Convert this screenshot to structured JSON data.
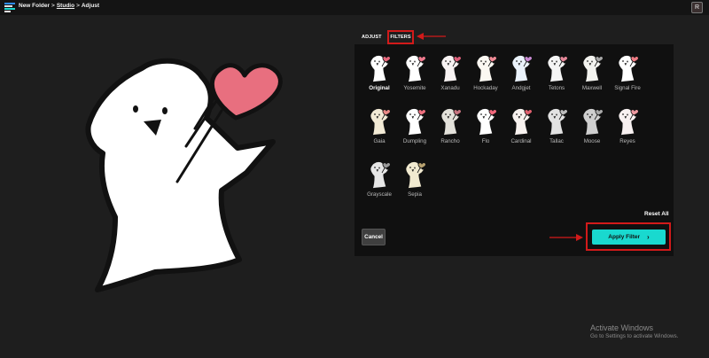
{
  "breadcrumb": {
    "folder": "New Folder",
    "separator": ">",
    "studio": "Studio",
    "current": "Adjust"
  },
  "user": {
    "initial": "R"
  },
  "tabs": {
    "adjust": "ADJUST",
    "filters": "FILTERS",
    "active": "FILTERS"
  },
  "filters": [
    {
      "name": "Original",
      "tint": "#ffffff",
      "heart": "#e7667b",
      "selected": true
    },
    {
      "name": "Yosemite",
      "tint": "#ffffff",
      "heart": "#f07a8e",
      "selected": false
    },
    {
      "name": "Xanadu",
      "tint": "#f7f2f2",
      "heart": "#de5f7a",
      "selected": false
    },
    {
      "name": "Hockaday",
      "tint": "#fbf8f2",
      "heart": "#f28c97",
      "selected": false
    },
    {
      "name": "Andgjet",
      "tint": "#eaf2fb",
      "heart": "#c98bd4",
      "selected": false
    },
    {
      "name": "Tetons",
      "tint": "#f4f4f4",
      "heart": "#e7889a",
      "selected": false
    },
    {
      "name": "Maxwell",
      "tint": "#f2f2ee",
      "heart": "#a7a7a7",
      "selected": false
    },
    {
      "name": "Signal Fire",
      "tint": "#ffffff",
      "heart": "#f07c85",
      "selected": false
    },
    {
      "name": "Gaia",
      "tint": "#f2ead5",
      "heart": "#e98a86",
      "selected": false
    },
    {
      "name": "Dumpling",
      "tint": "#ffffff",
      "heart": "#ef6f7e",
      "selected": false
    },
    {
      "name": "Rancho",
      "tint": "#e3e1da",
      "heart": "#c77580",
      "selected": false
    },
    {
      "name": "Flo",
      "tint": "#ffffff",
      "heart": "#f3687c",
      "selected": false
    },
    {
      "name": "Cardinal",
      "tint": "#f8f2ef",
      "heart": "#e0606e",
      "selected": false
    },
    {
      "name": "Tallac",
      "tint": "#e2e2e2",
      "heart": "#bdbdbd",
      "selected": false
    },
    {
      "name": "Moose",
      "tint": "#cfcfcf",
      "heart": "#a9a9a9",
      "selected": false
    },
    {
      "name": "Reyes",
      "tint": "#f8f1f1",
      "heart": "#ee9aa1",
      "selected": false
    },
    {
      "name": "Grayscale",
      "tint": "#e6e6e6",
      "heart": "#9a9a9a",
      "selected": false
    },
    {
      "name": "Sepia",
      "tint": "#f1ead0",
      "heart": "#b8a270",
      "selected": false
    }
  ],
  "actions": {
    "reset_all": "Reset All",
    "cancel": "Cancel",
    "apply_filter": "Apply Filter",
    "apply_chevron": "›"
  },
  "watermark": {
    "title": "Activate Windows",
    "subtitle": "Go to Settings to activate Windows."
  },
  "colors": {
    "accent": "#19d9cf",
    "highlight": "#d21a1a",
    "heart": "#e86f7f"
  }
}
